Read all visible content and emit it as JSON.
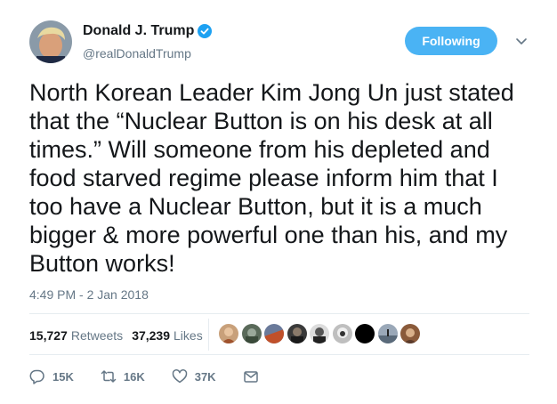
{
  "author": {
    "display_name": "Donald J. Trump",
    "handle": "@realDonaldTrump",
    "verified": true
  },
  "follow_button_label": "Following",
  "tweet": {
    "text": "North Korean Leader Kim Jong Un just stated that the “Nuclear Button is on his desk at all times.” Will someone from his depleted and food starved regime please inform him that I too have a Nuclear Button, but it is a much bigger & more powerful one than his, and my Button works!",
    "timestamp": "4:49 PM - 2 Jan 2018"
  },
  "stats": {
    "retweets_count": "15,727",
    "retweets_label": "Retweets",
    "likes_count": "37,239",
    "likes_label": "Likes"
  },
  "actions": {
    "reply_count": "15K",
    "retweet_count": "16K",
    "like_count": "37K"
  },
  "colors": {
    "accent": "#4ab3f4",
    "verified": "#1da1f2",
    "secondary_text": "#657786",
    "divider": "#e6ecf0"
  },
  "icons": [
    "verified-badge-icon",
    "chevron-down-icon",
    "reply-icon",
    "retweet-icon",
    "heart-icon",
    "direct-message-icon"
  ]
}
